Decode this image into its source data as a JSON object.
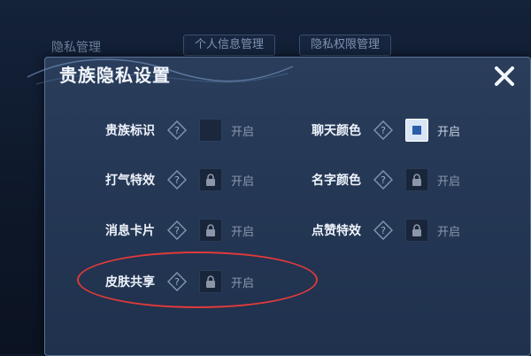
{
  "background": {
    "title": "隐私管理",
    "tabs": [
      "个人信息管理",
      "隐私权限管理"
    ]
  },
  "dialog": {
    "title": "贵族隐私设置",
    "close_icon": "close-icon",
    "settings": [
      {
        "label": "贵族标识",
        "state": "开启",
        "control": "empty"
      },
      {
        "label": "聊天颜色",
        "state": "开启",
        "control": "checked"
      },
      {
        "label": "打气特效",
        "state": "开启",
        "control": "locked"
      },
      {
        "label": "名字颜色",
        "state": "开启",
        "control": "locked"
      },
      {
        "label": "消息卡片",
        "state": "开启",
        "control": "locked"
      },
      {
        "label": "点赞特效",
        "state": "开启",
        "control": "locked"
      },
      {
        "label": "皮肤共享",
        "state": "开启",
        "control": "locked"
      }
    ]
  },
  "colors": {
    "panel": "#243754",
    "accent": "#2a5ea8",
    "highlight": "#e03a3a"
  }
}
